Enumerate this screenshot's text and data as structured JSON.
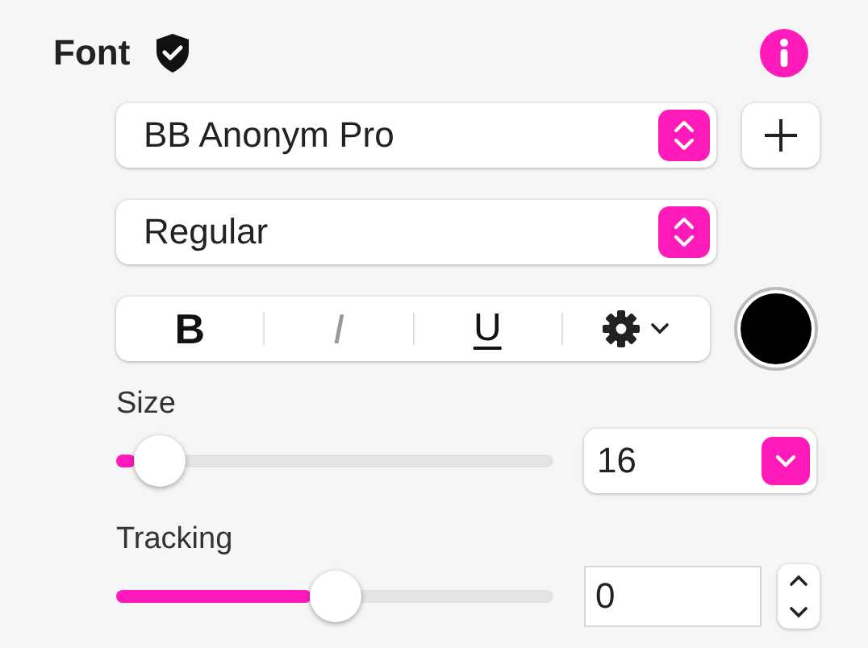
{
  "section": {
    "title": "Font"
  },
  "font_family": {
    "value": "BB Anonym Pro"
  },
  "font_style": {
    "value": "Regular"
  },
  "style_buttons": [
    {
      "kind": "bold",
      "label": "B",
      "disabled": false
    },
    {
      "kind": "italic",
      "label": "I",
      "disabled": true
    },
    {
      "kind": "underline",
      "label": "U",
      "disabled": false
    }
  ],
  "color_well": {
    "color": "#000000"
  },
  "size": {
    "label": "Size",
    "level": 0.1,
    "value": "16"
  },
  "tracking": {
    "label": "Tracking",
    "level": 0.5,
    "value": "0"
  }
}
